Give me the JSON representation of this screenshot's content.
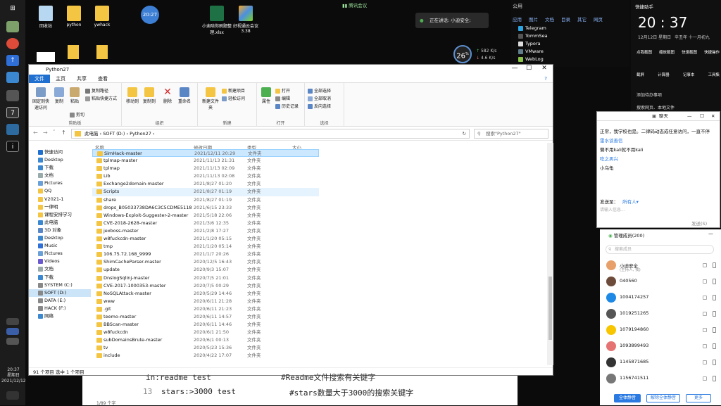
{
  "desktop": {
    "icons": [
      {
        "label": "回收站",
        "icon": "recycle-bin-icon"
      },
      {
        "label": "python",
        "icon": "folder-icon"
      },
      {
        "label": "ywhack",
        "icon": "folder-icon"
      },
      {
        "label": "20:27",
        "icon": "clock-widget-icon"
      },
      {
        "label": "小迪陪你刷题整理.xlsx",
        "icon": "excel-icon"
      },
      {
        "label": "好视通云会议 3.38",
        "icon": "cube-app-icon"
      }
    ],
    "meeting_bar": "腾讯会议",
    "talking": "正在讲话: 小迪安全;",
    "speed": {
      "percent": "26",
      "percent_unit": "%",
      "up": "582",
      "up_unit": "K/s",
      "down": "4.6",
      "down_unit": "K/s"
    }
  },
  "taskbar": {
    "clock_time": "20:37",
    "clock_day": "星期日",
    "clock_date": "2021/12/12"
  },
  "news": {
    "tabs": [
      "应用",
      "图片",
      "文档",
      "目录",
      "其它",
      "网页"
    ],
    "header": "公用",
    "items": [
      "Telegram",
      "TommSea",
      "Typora",
      "VMware",
      "WebLog"
    ]
  },
  "right_panel": {
    "title": "快捷助手",
    "time": "20 : 37",
    "date_line": "12月12日 星期日",
    "lunar": "辛丑年 十一月初九",
    "actions1": [
      "点我截图",
      "缩放截图",
      "快速截图",
      "快捷操作"
    ],
    "actions2": [
      "截屏",
      "计算器",
      "记事本",
      "工具集"
    ],
    "link1": "添加待办事项",
    "link2": "搜索网页、本地文件"
  },
  "explorer": {
    "title": "Python27",
    "window_controls": [
      "—",
      "☐",
      "✕"
    ],
    "tabs": [
      "文件",
      "主页",
      "共享",
      "查看"
    ],
    "ribbon": {
      "clipboard": {
        "label": "剪贴板",
        "pin": "固定到快速访问",
        "copy": "复制",
        "paste": "粘贴",
        "cut": "剪切",
        "copy_path": "复制路径",
        "paste_shortcut": "粘贴快捷方式"
      },
      "organize": {
        "label": "组织",
        "move_to": "移动到",
        "copy_to": "复制到",
        "delete": "删除",
        "rename": "重命名"
      },
      "new": {
        "label": "新建",
        "new_folder": "新建文件夹",
        "new_item": "新建项目",
        "easy_access": "轻松访问"
      },
      "open": {
        "label": "打开",
        "properties": "属性",
        "open": "打开",
        "edit": "编辑",
        "history": "历史记录"
      },
      "select": {
        "label": "选择",
        "select_all": "全部选择",
        "select_none": "全部取消",
        "invert": "反向选择"
      }
    },
    "address": "此电脑 › SOFT (D:) › Python27 ›",
    "search_placeholder": "搜索\"Python27\"",
    "nav": [
      {
        "label": "快速访问",
        "icon": "star-icon"
      },
      {
        "label": "Desktop",
        "icon": "desktop-icon"
      },
      {
        "label": "下载",
        "icon": "download-icon"
      },
      {
        "label": "文档",
        "icon": "document-icon"
      },
      {
        "label": "Pictures",
        "icon": "pictures-icon"
      },
      {
        "label": "QQ",
        "icon": "folder-icon"
      },
      {
        "label": "V2021-1",
        "icon": "folder-icon"
      },
      {
        "label": "一律明",
        "icon": "folder-icon"
      },
      {
        "label": "课程安排学习",
        "icon": "folder-icon"
      },
      {
        "label": "此电脑",
        "icon": "computer-icon"
      },
      {
        "label": "3D 对象",
        "icon": "cube-icon"
      },
      {
        "label": "Desktop",
        "icon": "desktop-icon"
      },
      {
        "label": "Music",
        "icon": "music-icon"
      },
      {
        "label": "Pictures",
        "icon": "pictures-icon"
      },
      {
        "label": "Videos",
        "icon": "video-icon"
      },
      {
        "label": "文档",
        "icon": "document-icon"
      },
      {
        "label": "下载",
        "icon": "download-icon"
      },
      {
        "label": "SYSTEM (C:)",
        "icon": "drive-icon"
      },
      {
        "label": "SOFT (D:)",
        "icon": "drive-icon"
      },
      {
        "label": "DATA (E:)",
        "icon": "drive-icon"
      },
      {
        "label": "HACK (F:)",
        "icon": "drive-icon"
      },
      {
        "label": "网络",
        "icon": "network-icon"
      }
    ],
    "columns": [
      "名称",
      "修改日期",
      "类型",
      "大小"
    ],
    "files": [
      {
        "name": "SimHack-master",
        "date": "2021/12/11 20:29",
        "type": "文件夹"
      },
      {
        "name": "tplmap-master",
        "date": "2021/11/13 21:31",
        "type": "文件夹"
      },
      {
        "name": "tplmap",
        "date": "2021/11/13 02:09",
        "type": "文件夹"
      },
      {
        "name": "Lib",
        "date": "2021/11/13 02:08",
        "type": "文件夹"
      },
      {
        "name": "Exchange2domain-master",
        "date": "2021/8/27 01:20",
        "type": "文件夹"
      },
      {
        "name": "Scripts",
        "date": "2021/8/27 01:19",
        "type": "文件夹"
      },
      {
        "name": "share",
        "date": "2021/8/27 01:19",
        "type": "文件夹"
      },
      {
        "name": "drops_B05033738DA6C3C5CDME5118...",
        "date": "2021/6/15 23:33",
        "type": "文件夹"
      },
      {
        "name": "Windows-Exploit-Suggester-2-master",
        "date": "2021/5/18 22:06",
        "type": "文件夹"
      },
      {
        "name": "CVE-2018-2628-master",
        "date": "2021/3/6 12:35",
        "type": "文件夹"
      },
      {
        "name": "jexboss-master",
        "date": "2021/2/8 17:27",
        "type": "文件夹"
      },
      {
        "name": "w8fuckcdn-master",
        "date": "2021/1/20 05:15",
        "type": "文件夹"
      },
      {
        "name": "tmp",
        "date": "2021/1/20 05:14",
        "type": "文件夹"
      },
      {
        "name": "106.75.72.168_9999",
        "date": "2021/1/7 20:26",
        "type": "文件夹"
      },
      {
        "name": "ShimCacheParser-master",
        "date": "2020/12/5 16:43",
        "type": "文件夹"
      },
      {
        "name": "update",
        "date": "2020/9/3 15:07",
        "type": "文件夹"
      },
      {
        "name": "DnslogSqlinj-master",
        "date": "2020/7/5 21:01",
        "type": "文件夹"
      },
      {
        "name": "CVE-2017-1000353-master",
        "date": "2020/7/5 00:29",
        "type": "文件夹"
      },
      {
        "name": "NoSQLAttack-master",
        "date": "2020/5/29 14:46",
        "type": "文件夹"
      },
      {
        "name": "www",
        "date": "2020/6/11 21:28",
        "type": "文件夹"
      },
      {
        "name": ".git",
        "date": "2020/6/11 21:23",
        "type": "文件夹"
      },
      {
        "name": "teemo-master",
        "date": "2020/6/11 14:57",
        "type": "文件夹"
      },
      {
        "name": "BBScan-master",
        "date": "2020/6/11 14:46",
        "type": "文件夹"
      },
      {
        "name": "w8fuckcdn",
        "date": "2020/6/1 21:50",
        "type": "文件夹"
      },
      {
        "name": "subDomainsBrute-master",
        "date": "2020/6/1 00:13",
        "type": "文件夹"
      },
      {
        "name": "tv",
        "date": "2020/5/23 15:36",
        "type": "文件夹"
      },
      {
        "name": "include",
        "date": "2020/4/22 17:07",
        "type": "文件夹"
      }
    ],
    "status": "91 个项目    选中 1 个项目"
  },
  "editor": {
    "line1": "in:readme test               #Readme文件搜索有关键字",
    "line2_no": "13",
    "line2_code": "stars:>3000 test",
    "line2_comment": "#stars数量大于3000的搜索关键字",
    "footer": "1/89 个字"
  },
  "chat": {
    "title": "聊天",
    "messages": [
      {
        "text": "正常，我学校也是。二律码动态成任意访问，一直不停",
        "color": "#111"
      },
      {
        "text": "雷水谈善信",
        "color": "#2a7ae2"
      },
      {
        "text": "懒不用kali就不用kali",
        "color": "#111"
      },
      {
        "text": "吃之男兴",
        "color": "#2a7ae2"
      },
      {
        "text": "小乌龟",
        "color": "#111"
      }
    ],
    "send_to_label": "发送至：",
    "send_to_value": "所有人",
    "input_placeholder": "请输入信息...",
    "send_button": "发送(S)"
  },
  "members": {
    "title": "管理成员(200)",
    "search_placeholder": "搜索成员",
    "list": [
      {
        "name": "小迪安全",
        "sub": "(主持人, 我)",
        "color": "#e8a06a"
      },
      {
        "name": "040560",
        "color": "#6d4b3a"
      },
      {
        "name": "1004174257",
        "color": "#1e88e5"
      },
      {
        "name": "1019251265",
        "color": "#555555"
      },
      {
        "name": "1079194860",
        "color": "#f7c600"
      },
      {
        "name": "1093899493",
        "color": "#e57373"
      },
      {
        "name": "1145871685",
        "color": "#333333"
      },
      {
        "name": "1156741511",
        "color": "#777777"
      }
    ],
    "buttons": [
      "全体静音",
      "解除全体静音",
      "更多"
    ]
  }
}
